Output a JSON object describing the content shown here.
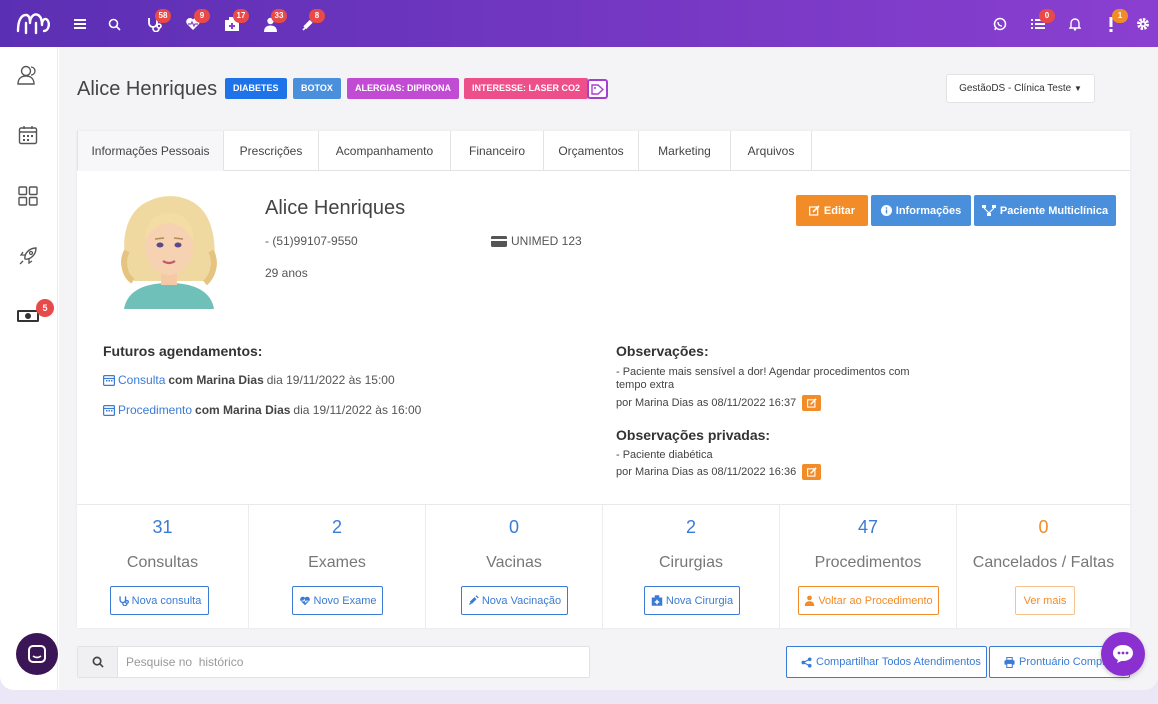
{
  "topbar": {
    "badges": {
      "stethoscope": "58",
      "heart": "9",
      "clinic": "17",
      "doctor": "33",
      "syringe": "8",
      "list": "0",
      "alert": "1"
    }
  },
  "sidebar": {
    "money_badge": "5"
  },
  "header": {
    "patient_name": "Alice Henriques",
    "tags": [
      {
        "label": "DIABETES",
        "color": "#1e73e8"
      },
      {
        "label": "BOTOX",
        "color": "#4a8fdc"
      },
      {
        "label": "ALERGIAS: DIPIRONA",
        "color": "#c24bd3"
      },
      {
        "label": "INTERESSE: LASER CO2",
        "color": "#ec4f8a"
      }
    ],
    "clinic_select": "GestãoDS - Clínica Teste"
  },
  "tabs": [
    "Informações Pessoais",
    "Prescrições",
    "Acompanhamento",
    "Financeiro",
    "Orçamentos",
    "Marketing",
    "Arquivos"
  ],
  "profile": {
    "name": "Alice Henriques",
    "phone": "- (51)99107-9550",
    "insurance": "UNIMED 123",
    "age": "29 anos"
  },
  "actions": {
    "edit": "Editar",
    "info": "Informações",
    "multiclinic": "Paciente Multiclínica"
  },
  "appointments": {
    "title": "Futuros agendamentos:",
    "items": [
      {
        "type": "Consulta",
        "with": "com Marina Dias",
        "when": "dia 19/11/2022 às 15:00"
      },
      {
        "type": "Procedimento",
        "with": "com Marina Dias",
        "when": "dia 19/11/2022 às 16:00"
      }
    ]
  },
  "observations": {
    "title": "Observações:",
    "text": "- Paciente mais sensível a dor! Agendar procedimentos com tempo extra",
    "meta": "por Marina Dias as 08/11/2022 16:37",
    "private_title": "Observações privadas:",
    "private_text": "- Paciente diabética",
    "private_meta": "por Marina Dias as 08/11/2022 16:36"
  },
  "stats": [
    {
      "value": "31",
      "label": "Consultas",
      "button": "Nova consulta"
    },
    {
      "value": "2",
      "label": "Exames",
      "button": "Novo Exame"
    },
    {
      "value": "0",
      "label": "Vacinas",
      "button": "Nova Vacinação"
    },
    {
      "value": "2",
      "label": "Cirurgias",
      "button": "Nova Cirurgia"
    },
    {
      "value": "47",
      "label": "Procedimentos",
      "button": "Voltar ao Procedimento"
    },
    {
      "value": "0",
      "label": "Cancelados / Faltas",
      "button": "Ver mais"
    }
  ],
  "search": {
    "placeholder": "Pesquise no  histórico"
  },
  "footer": {
    "share": "Compartilhar Todos Atendimentos",
    "record": "Prontuário Completo"
  },
  "colors": {
    "accent": "#3a7bd5",
    "orange": "#f28c28",
    "purple": "#7b3dc8"
  }
}
